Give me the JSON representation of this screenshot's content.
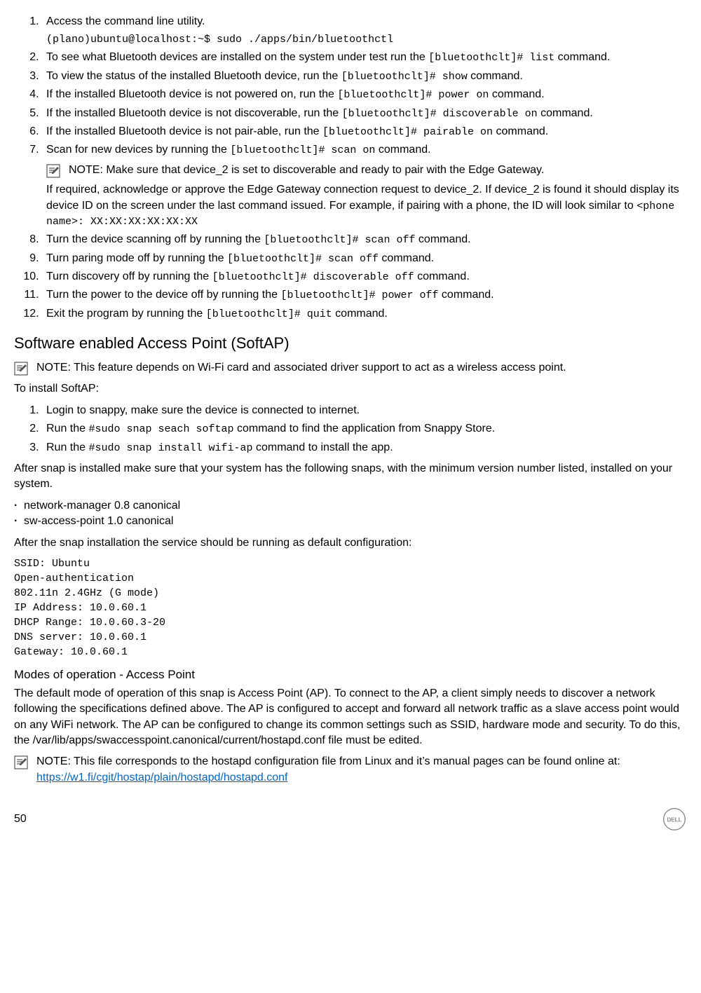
{
  "list1": {
    "i1": {
      "text": "Access the command line utility.",
      "cmd": "(plano)ubuntu@localhost:~$ sudo ./apps/bin/bluetoothctl"
    },
    "i2": {
      "pre": "To see what Bluetooth devices are installed on the system under test run the ",
      "code": "[bluetoothclt]# list",
      "post": " command."
    },
    "i3": {
      "pre": "To view the status of the installed Bluetooth device, run the ",
      "code": "[bluetoothclt]# show",
      "post": " command."
    },
    "i4": {
      "pre": "If the installed Bluetooth device is not powered on, run the ",
      "code": "[bluetoothclt]# power on",
      "post": " command."
    },
    "i5": {
      "pre": "If the installed Bluetooth device is not discoverable, run the ",
      "code": "[bluetoothclt]# discoverable on",
      "post": " command."
    },
    "i6": {
      "pre": "If the installed Bluetooth device is not pair-able, run the ",
      "code": "[bluetoothclt]# pairable on",
      "post": " command."
    },
    "i7": {
      "pre": "Scan for new devices by running the ",
      "code": "[bluetoothclt]# scan on",
      "post": " command.",
      "note": "NOTE: Make sure that device_2 is set to discoverable and ready to pair with the Edge Gateway.",
      "para_pre": "If required, acknowledge or approve the Edge Gateway connection request to device_2. If device_2 is found it should display its device ID on the screen under the last command issued. For example, if pairing with a phone, the ID will look similar to ",
      "para_code": "<phone name>: XX:XX:XX:XX:XX:XX"
    },
    "i8": {
      "pre": "Turn the device scanning off by running the ",
      "code": "[bluetoothclt]# scan off",
      "post": " command."
    },
    "i9": {
      "pre": "Turn paring mode off by running the ",
      "code": "[bluetoothclt]# scan off",
      "post": " command."
    },
    "i10": {
      "pre": "Turn discovery off by running the ",
      "code": "[bluetoothclt]# discoverable off",
      "post": " command."
    },
    "i11": {
      "pre": "Turn the power to the device off by running the ",
      "code": "[bluetoothclt]# power off",
      "post": " command."
    },
    "i12": {
      "pre": "Exit the program by running the ",
      "code": "[bluetoothclt]# quit",
      "post": " command."
    }
  },
  "softap": {
    "heading": "Software enabled Access Point (SoftAP)",
    "note": "NOTE: This feature depends on Wi-Fi card and associated driver support to act as a wireless access point.",
    "intro": "To install SoftAP:",
    "steps": {
      "s1": "Login to snappy, make sure the device is connected to internet.",
      "s2": {
        "pre": "Run the ",
        "code": "#sudo snap seach softap",
        "post": " command to find the application from Snappy Store."
      },
      "s3": {
        "pre": "Run the ",
        "code": "#sudo snap install wifi-ap",
        "post": " command to install the app."
      }
    },
    "after_install": "After snap is installed make sure that your system has the following snaps, with the minimum version number listed, installed on your system.",
    "bullets": {
      "b1": "network-manager 0.8 canonical",
      "b2": "sw-access-point 1.0 canonical"
    },
    "after_snap": "After the snap installation the service should be running as default configuration:",
    "config": "SSID: Ubuntu\nOpen-authentication\n802.11n 2.4GHz (G mode)\nIP Address: 10.0.60.1\nDHCP Range: 10.0.60.3-20\nDNS server: 10.0.60.1\nGateway: 10.0.60.1",
    "modes_heading": "Modes of operation - Access Point",
    "modes_para": "The default mode of operation of this snap is Access Point (AP). To connect to the AP, a client simply needs to discover a network following the specifications defined above. The AP is configured to accept and forward all network traffic as a slave access point would on any WiFi network. The AP can be configured to change its common settings such as SSID, hardware mode and security. To do this, the /var/lib/apps/swaccesspoint.canonical/current/hostapd.conf file must be edited.",
    "note2_pre": "NOTE: This file corresponds to the hostapd configuration file from Linux and it’s manual pages can be found online at: ",
    "note2_link": "https://w1.fi/cgit/hostap/plain/hostapd/hostapd.conf"
  },
  "footer": {
    "page": "50"
  }
}
